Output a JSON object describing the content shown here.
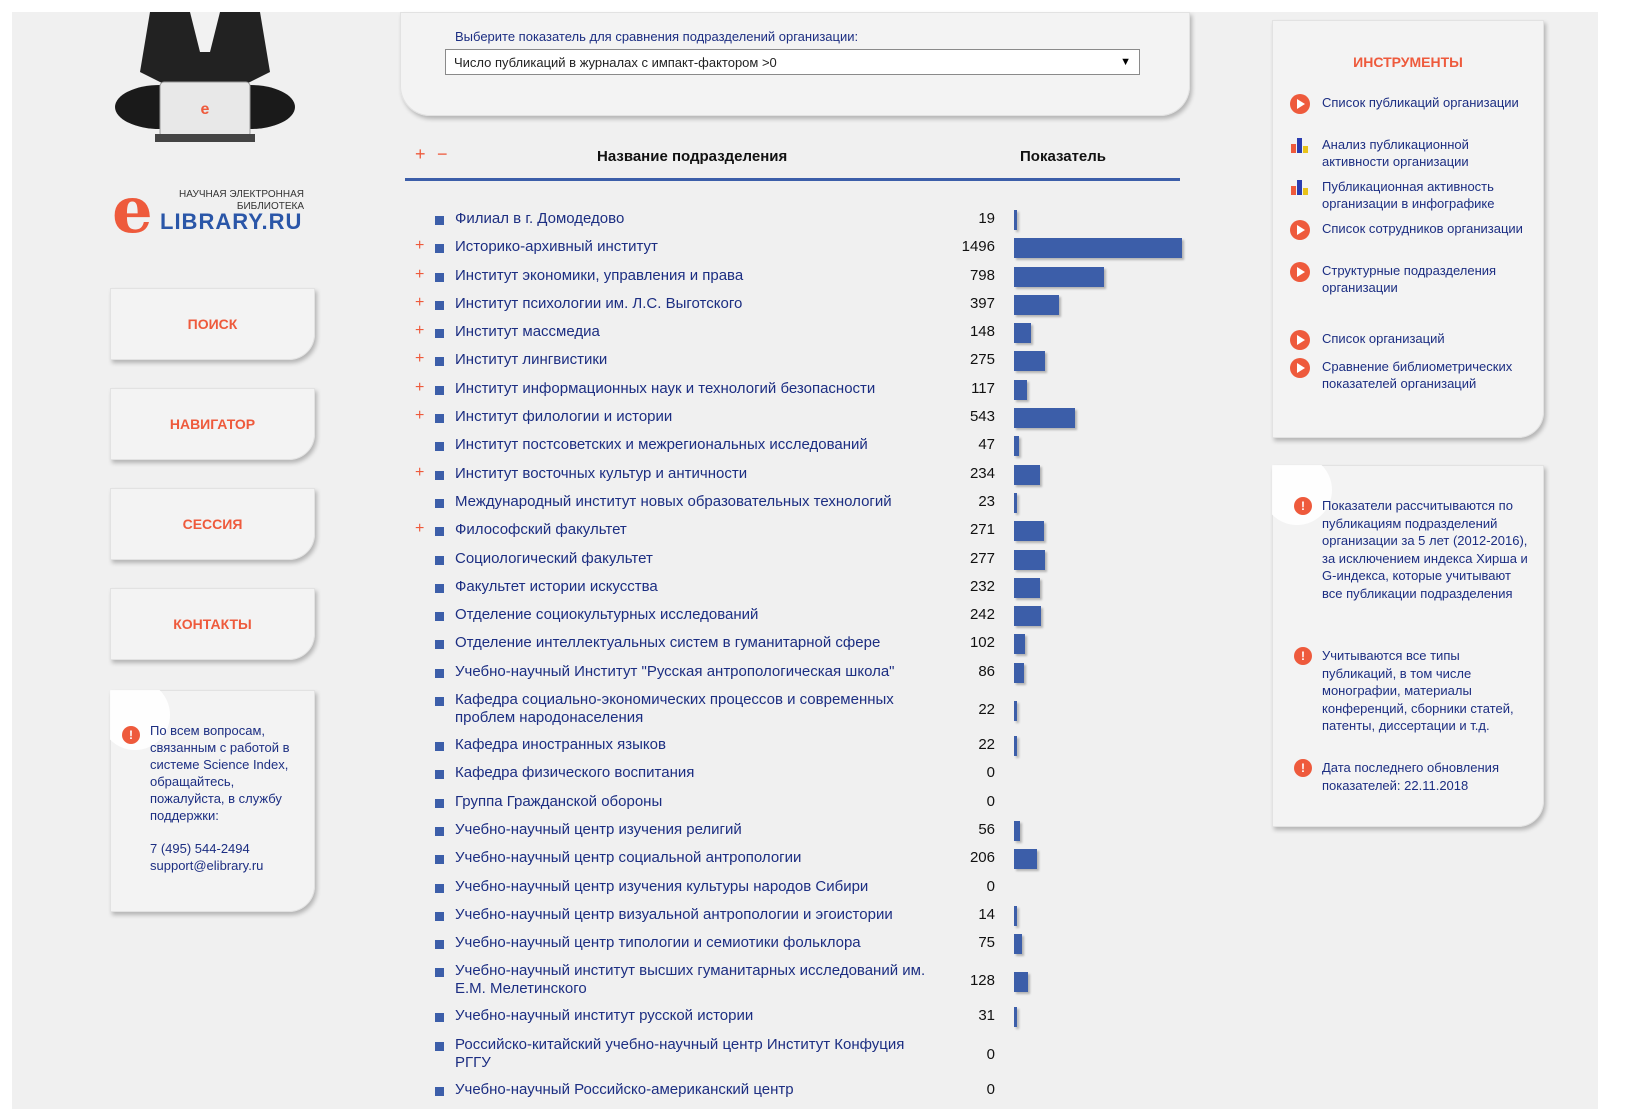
{
  "sidebar": {
    "logo_top": "НАУЧНАЯ ЭЛЕКТРОННАЯ БИБЛИОТЕКА",
    "logo_letter": "e",
    "logo_main": "LIBRARY.RU",
    "nav": [
      "ПОИСК",
      "НАВИГАТОР",
      "СЕССИЯ",
      "КОНТАКТЫ"
    ],
    "help_text": "По всем вопросам, связанным с работой в системе Science Index, обращайтесь, пожалуйста, в службу поддержки:",
    "phone": "7 (495) 544-2494",
    "email": "support@elibrary.ru"
  },
  "selector": {
    "label": "Выберите показатель для сравнения подразделений организации:",
    "value": "Число публикаций в журналах с импакт-фактором >0"
  },
  "table": {
    "expand": "+",
    "collapse": "−",
    "col_name": "Название подразделения",
    "col_value": "Показатель",
    "max_value": 1496,
    "rows": [
      {
        "name": "Филиал в г. Домодедово",
        "value": "19",
        "expandable": false
      },
      {
        "name": "Историко-архивный институт",
        "value": "1496",
        "expandable": true
      },
      {
        "name": "Институт экономики, управления и права",
        "value": "798",
        "expandable": true
      },
      {
        "name": "Институт психологии им. Л.С. Выготского",
        "value": "397",
        "expandable": true
      },
      {
        "name": "Институт массмедиа",
        "value": "148",
        "expandable": true
      },
      {
        "name": "Институт лингвистики",
        "value": "275",
        "expandable": true
      },
      {
        "name": "Институт информационных наук и технологий безопасности",
        "value": "117",
        "expandable": true
      },
      {
        "name": "Институт филологии и истории",
        "value": "543",
        "expandable": true
      },
      {
        "name": "Институт постсоветских и межрегиональных исследований",
        "value": "47",
        "expandable": false
      },
      {
        "name": "Институт восточных культур и античности",
        "value": "234",
        "expandable": true
      },
      {
        "name": "Международный институт новых образовательных технологий",
        "value": "23",
        "expandable": false
      },
      {
        "name": "Философский факультет",
        "value": "271",
        "expandable": true
      },
      {
        "name": "Социологический факультет",
        "value": "277",
        "expandable": false
      },
      {
        "name": "Факультет истории искусства",
        "value": "232",
        "expandable": false
      },
      {
        "name": "Отделение социокультурных исследований",
        "value": "242",
        "expandable": false
      },
      {
        "name": "Отделение интеллектуальных систем в гуманитарной сфере",
        "value": "102",
        "expandable": false
      },
      {
        "name": "Учебно-научный Институт \"Русская антропологическая школа\"",
        "value": "86",
        "expandable": false
      },
      {
        "name": "Кафедра социально-экономических процессов и современных проблем народонаселения",
        "value": "22",
        "expandable": false
      },
      {
        "name": "Кафедра иностранных языков",
        "value": "22",
        "expandable": false
      },
      {
        "name": "Кафедра физического воспитания",
        "value": "0",
        "expandable": false
      },
      {
        "name": "Группа Гражданской обороны",
        "value": "0",
        "expandable": false
      },
      {
        "name": "Учебно-научный центр изучения религий",
        "value": "56",
        "expandable": false
      },
      {
        "name": "Учебно-научный центр социальной антропологии",
        "value": "206",
        "expandable": false
      },
      {
        "name": "Учебно-научный центр изучения культуры народов Сибири",
        "value": "0",
        "expandable": false
      },
      {
        "name": "Учебно-научный центр визуальной антропологии и эгоистории",
        "value": "14",
        "expandable": false
      },
      {
        "name": "Учебно-научный центр типологии и семиотики фольклора",
        "value": "75",
        "expandable": false
      },
      {
        "name": "Учебно-научный институт высших гуманитарных исследований им. Е.М. Мелетинского",
        "value": "128",
        "expandable": false
      },
      {
        "name": "Учебно-научный институт русской истории",
        "value": "31",
        "expandable": false
      },
      {
        "name": "Российско-китайский учебно-научный центр Институт Конфуция РГГУ",
        "value": "0",
        "expandable": false
      },
      {
        "name": "Учебно-научный Российско-американский центр",
        "value": "0",
        "expandable": false
      }
    ]
  },
  "tools": {
    "title": "ИНСТРУМЕНТЫ",
    "items": [
      {
        "label": "Список публикаций организации",
        "icon": "play-icon"
      },
      {
        "label": "Анализ публикационной активности организации",
        "icon": "bar-chart-icon"
      },
      {
        "label": "Публикационная активность организации в инфографике",
        "icon": "bar-chart-icon"
      },
      {
        "label": "Список сотрудников организации",
        "icon": "play-icon"
      },
      {
        "label": "Структурные подразделения организации",
        "icon": "play-icon"
      },
      {
        "label": "Список организаций",
        "icon": "play-icon"
      },
      {
        "label": "Сравнение библиометрических показателей организаций",
        "icon": "play-icon"
      }
    ]
  },
  "notes": [
    "Показатели рассчитываются по публикациям подразделений организации за 5 лет (2012-2016), за исключением индекса Хирша и G-индекса, которые учитывают все публикации подразделения",
    "Учитываются все типы публикаций, в том числе монографии, материалы конференций, сборники статей, патенты, диссертации и т.д.",
    "Дата последнего обновления показателей: 22.11.2018"
  ],
  "colors": {
    "accent": "#ee5a3c",
    "link": "#1c2e82",
    "bar": "#3c5ea9"
  }
}
